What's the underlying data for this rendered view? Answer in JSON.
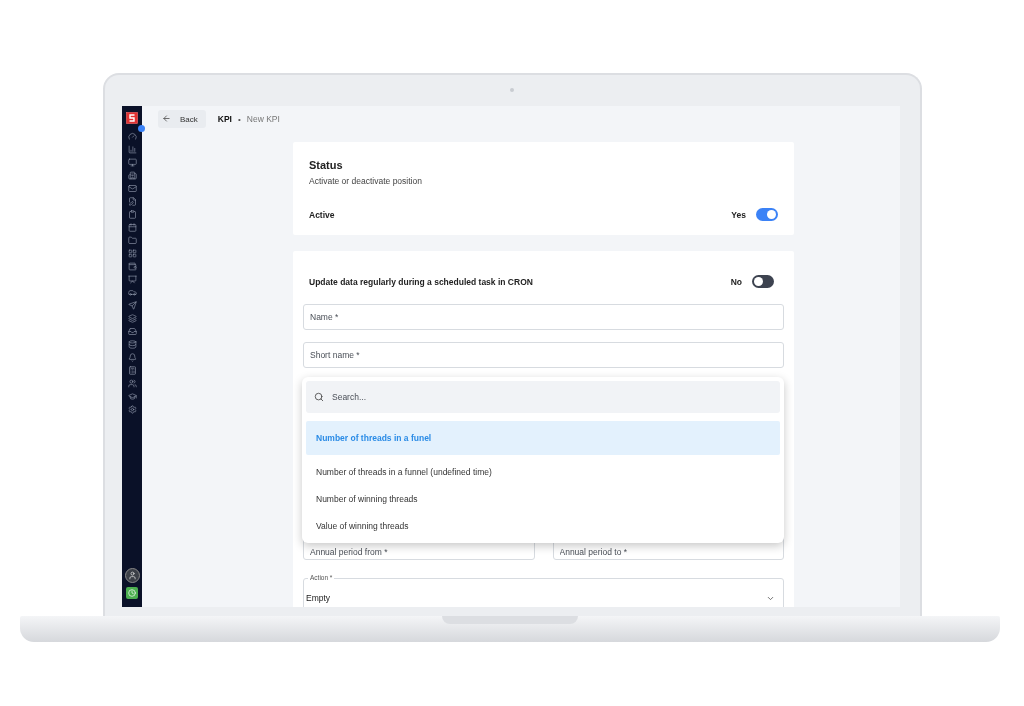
{
  "header": {
    "back_button": "Back",
    "breadcrumb": [
      "KPI",
      "New KPI"
    ],
    "separator": "•"
  },
  "status_card": {
    "title": "Status",
    "subtitle": "Activate or deactivate position",
    "toggle": {
      "label": "Active",
      "value_label": "Yes",
      "on": true
    }
  },
  "form_card": {
    "cron_toggle": {
      "label": "Update data regularly during a scheduled task in CRON",
      "value_label": "No",
      "on": false
    },
    "fields": [
      {
        "placeholder": "Name *"
      },
      {
        "placeholder": "Short name *"
      }
    ],
    "dropdown": {
      "search_placeholder": "Search...",
      "options": [
        {
          "label": "Number of threads in a funel",
          "selected": true
        },
        {
          "label": "Number of threads in a funnel (undefined time)",
          "selected": false
        },
        {
          "label": "Number of winning threads",
          "selected": false
        },
        {
          "label": "Value of winning threads",
          "selected": false
        }
      ]
    },
    "period_fields": [
      {
        "placeholder": "Annual period from *"
      },
      {
        "placeholder": "Annual period to *"
      }
    ],
    "action_select": {
      "label": "Action *",
      "value": "Empty"
    }
  }
}
